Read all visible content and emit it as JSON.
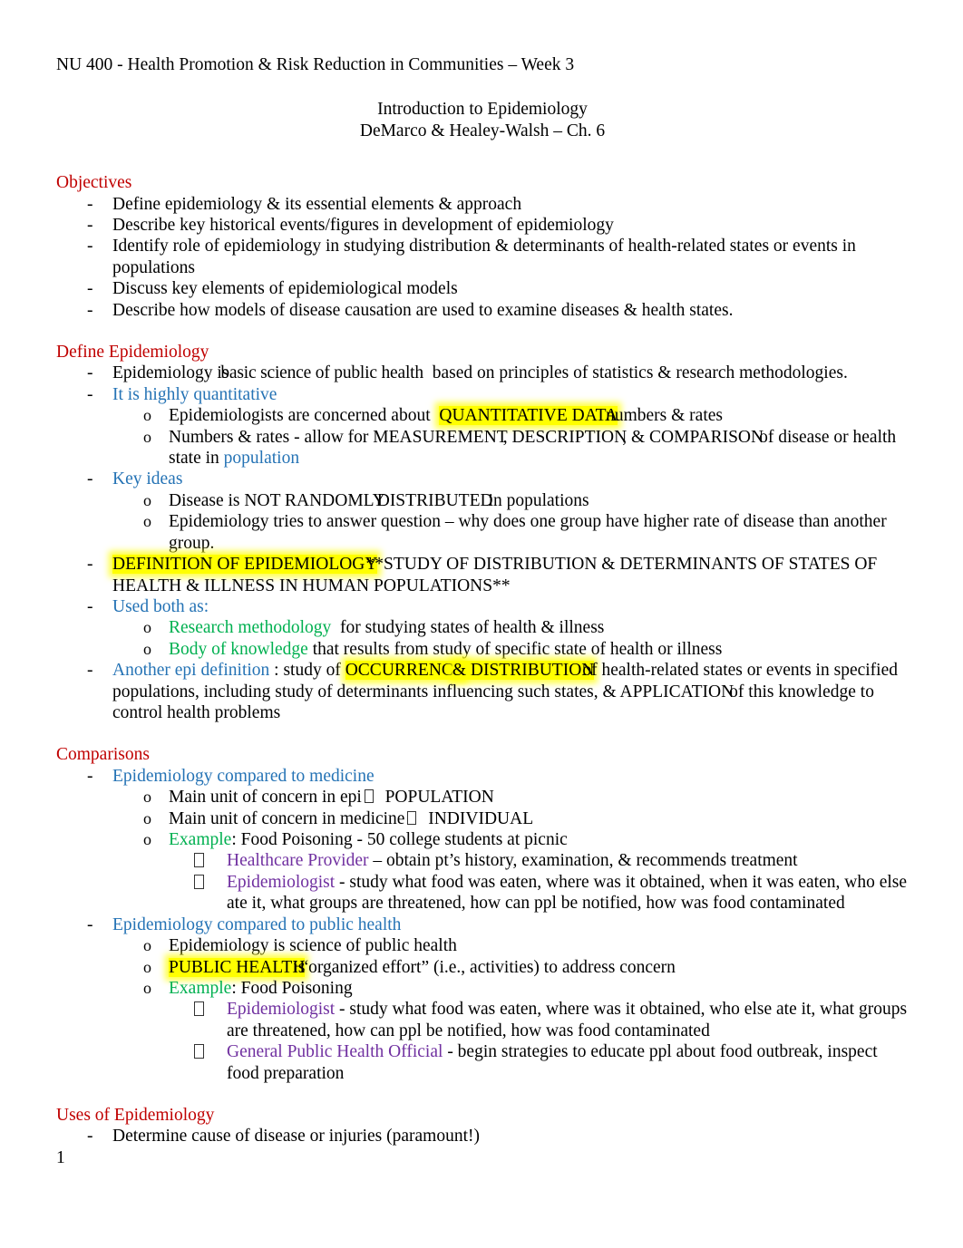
{
  "document": {
    "header": "NU 400 - Health Promotion & Risk Reduction in Communities – Week 3",
    "title_line1": "Introduction to Epidemiology",
    "title_line2": "DeMarco & Healey-Walsh – Ch. 6",
    "page_number": "1"
  },
  "colors": {
    "heading_red": "#C00000",
    "accent_blue": "#2573B5",
    "accent_green": "#00B050",
    "accent_purple": "#7030A0",
    "highlight_yellow": "#FFFF00"
  },
  "sections": {
    "objectives": {
      "heading": "Objectives",
      "bullet": "-",
      "items": [
        "Define epidemiology & its essential elements & approach",
        "Describe key historical events/figures in development of epidemiology",
        "Identify role of epidemiology in studying distribution & determinants of health-related states or events in populations",
        "Discuss key elements of epidemiological models",
        "Describe how models of disease causation are used to examine diseases & health states."
      ]
    },
    "define_epidemiology": {
      "heading": "Define Epidemiology",
      "bullet": "-",
      "sub_bullet": "o",
      "item1_a": "Epidemiology is",
      "item1_b": "basic science of public health",
      "item1_c": "based on principles of statistics & research methodologies.",
      "quantitative_label": "It is highly quantitative",
      "quant_sub1_a": "Epidemiologists are concerned about",
      "quant_sub1_hl": "QUANTITATIVE DATA",
      "quant_sub1_b": "numbers & rates",
      "quant_sub2_a": "Numbers & rates - allow for",
      "quant_sub2_m": "MEASUREMENT",
      "quant_sub2_d": ", DESCRIPTION",
      "quant_sub2_c": ", & COMPARISON",
      "quant_sub2_b": "of disease or health state in",
      "quant_sub2_pop": "population",
      "key_ideas_label": "Key ideas",
      "key1_a": "Disease is",
      "key1_b": "NOT RANDOMLY",
      "key1_c": "DISTRIBUTED",
      "key1_d": "in populations",
      "key2": "Epidemiology tries to answer question – why does one group have higher rate of disease than another group.",
      "definition_hl": "DEFINITION OF EPIDEMIOLOGY",
      "definition_rest": "**STUDY OF DISTRIBUTION & DETERMINANTS OF STATES OF HEALTH & ILLNESS IN HUMAN POPULATIONS**",
      "used_both_label": "Used both as:",
      "used1_green": "Research methodology",
      "used1_rest": "for studying states of health & illness",
      "used2_green": "Body of knowledge",
      "used2_rest": "that results from study of specific state of health or illness",
      "another_def_label": "Another epi definition",
      "another_def_a": ": study of",
      "another_def_hl1": "OCCURRENCE",
      "another_def_hl2": "& DISTRIBUTION",
      "another_def_b": "of health-related states or events in specified populations, including study of determinants influencing such states, &",
      "another_def_app": "APPLICATION",
      "another_def_c": "of this knowledge to control health problems"
    },
    "comparisons": {
      "heading": "Comparisons",
      "bullet": "-",
      "sub_bullet": "o",
      "medicine_label": "Epidemiology compared to  medicine",
      "med_item1_a": "Main unit of concern in epi",
      "med_item1_b": "POPULATION",
      "med_item2_a": "Main unit of concern in medicine",
      "med_item2_b": "INDIVIDUAL",
      "med_example_label": "Example",
      "med_example_rest": ":  Food Poisoning - 50 college students at picnic",
      "med_sub1_purple": "Healthcare Provider",
      "med_sub1_rest": "– obtain pt’s history, examination, & recommends treatment",
      "med_sub2_purple": "Epidemiologist",
      "med_sub2_rest": "- study what food was eaten, where was it obtained, when it was eaten, who else ate it, what groups are threatened, how can ppl be notified, how was food contaminated",
      "ph_label": "Epidemiology compared to  public health",
      "ph_item1": "Epidemiology is science of public health",
      "ph_item2_hl": "PUBLIC HEALTH",
      "ph_item2_is": "is",
      "ph_item2_rest": "“organized effort” (i.e., activities) to address concern",
      "ph_example_label": "Example",
      "ph_example_rest": ": Food Poisoning",
      "ph_sub1_purple": "Epidemiologist",
      "ph_sub1_rest": "- study what food was eaten, where was it obtained, who else ate it, what groups are threatened, how can ppl be notified, how was food contaminated",
      "ph_sub2_purple": "General Public Health Official",
      "ph_sub2_rest": "- begin strategies to educate ppl about food outbreak, inspect food preparation"
    },
    "uses": {
      "heading": "Uses of Epidemiology",
      "bullet": "-",
      "item1": "Determine cause of disease or injuries   (paramount!)"
    }
  },
  "icons": {
    "arrow_glyph": "missing-glyph-box",
    "list_marker_dash": "-",
    "list_marker_o": "o"
  }
}
